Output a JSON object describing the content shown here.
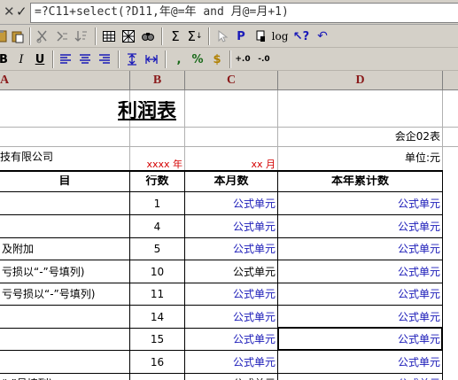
{
  "formula_bar": {
    "cancel_glyph": "✕",
    "confirm_glyph": "✓",
    "formula": "=?C11+select(?D11,年@=年 and 月@=月+1)"
  },
  "toolbar_row1": {
    "icons": [
      "paste-icon",
      "cut-icon",
      "insert-row-icon",
      "sort-icon",
      "grid-icon",
      "pattern-icon",
      "find-icon",
      "sum-icon",
      "sum-select-icon",
      "pointer-icon",
      "bold-p-icon",
      "flag-icon",
      "log-icon",
      "help-cursor-icon",
      "undo-icon"
    ],
    "labels": {
      "log": "log"
    }
  },
  "toolbar_row2": {
    "bold": "B",
    "underline": "U",
    "comma": ",",
    "percent": "%",
    "currency": "$",
    "inc_decimal": "+.0",
    "dec_decimal": "-.0"
  },
  "columns": [
    "A",
    "B",
    "C",
    "D"
  ],
  "sheet": {
    "title": "利润表",
    "form_code": "会企02表",
    "company": "技有限公司",
    "year_label": "xxxx 年",
    "month_label": "xx 月",
    "unit": "单位:元",
    "headers": {
      "item": "目",
      "row_no": "行数",
      "month": "本月数",
      "ytd": "本年累计数"
    },
    "rows": [
      {
        "item": "",
        "no": "1",
        "month": "公式单元",
        "ytd": "公式单元",
        "month_blue": true
      },
      {
        "item": "",
        "no": "4",
        "month": "公式单元",
        "ytd": "公式单元",
        "month_blue": true
      },
      {
        "item": "及附加",
        "no": "5",
        "month": "公式单元",
        "ytd": "公式单元",
        "month_blue": true
      },
      {
        "item": "亏损以“-”号填列)",
        "no": "10",
        "month": "公式单元",
        "ytd": "公式单元",
        "month_blue": false
      },
      {
        "item": "亏号损以“-”号填列)",
        "no": "11",
        "month": "公式单元",
        "ytd": "公式单元",
        "month_blue": true
      },
      {
        "item": "",
        "no": "14",
        "month": "公式单元",
        "ytd": "公式单元",
        "month_blue": true
      },
      {
        "item": "",
        "no": "15",
        "month": "公式单元",
        "ytd": "公式单元",
        "month_blue": true,
        "ytd_selected": true
      },
      {
        "item": "",
        "no": "16",
        "month": "公式单元",
        "ytd": "公式单元",
        "month_blue": true
      },
      {
        "item": "“-”号填列)",
        "no": "",
        "month": "公式单元",
        "ytd": "公式单元",
        "month_blue": false
      }
    ]
  },
  "colors": {
    "formula_blue": "#1a1ab8",
    "accent_red": "#d40000",
    "header_red": "#8a1a1a"
  }
}
